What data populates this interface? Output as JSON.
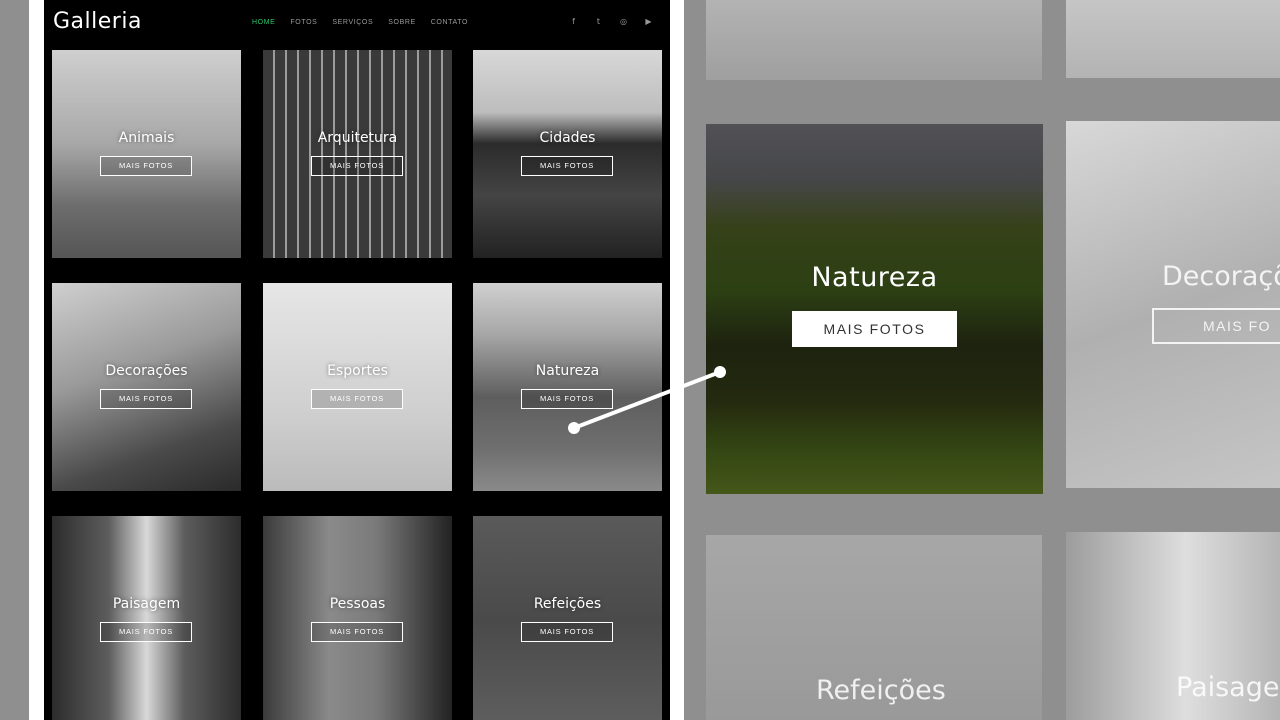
{
  "site": {
    "logo": "Galleria",
    "nav": [
      {
        "label": "HOME",
        "active": true
      },
      {
        "label": "FOTOS",
        "active": false
      },
      {
        "label": "SERVIÇOS",
        "active": false
      },
      {
        "label": "SOBRE",
        "active": false
      },
      {
        "label": "CONTATO",
        "active": false
      }
    ],
    "socials": [
      {
        "icon": "facebook-icon",
        "glyph": "f"
      },
      {
        "icon": "twitter-icon",
        "glyph": "t"
      },
      {
        "icon": "instagram-icon",
        "glyph": "◎"
      },
      {
        "icon": "youtube-icon",
        "glyph": "▶"
      }
    ],
    "accent_color": "#2ec66f",
    "tiles": [
      {
        "title": "Animais",
        "button": "MAIS FOTOS"
      },
      {
        "title": "Arquitetura",
        "button": "MAIS FOTOS"
      },
      {
        "title": "Cidades",
        "button": "MAIS FOTOS"
      },
      {
        "title": "Decorações",
        "button": "MAIS FOTOS"
      },
      {
        "title": "Esportes",
        "button": "MAIS FOTOS"
      },
      {
        "title": "Natureza",
        "button": "MAIS FOTOS"
      },
      {
        "title": "Paisagem",
        "button": "MAIS FOTOS"
      },
      {
        "title": "Pessoas",
        "button": "MAIS FOTOS"
      },
      {
        "title": "Refeições",
        "button": "MAIS FOTOS"
      }
    ]
  },
  "zoom": {
    "title": "Natureza",
    "button": "MAIS FOTOS",
    "ghost_right_title": "Decoraçõ",
    "ghost_right_button": "MAIS FO",
    "ghost_bottom_left": "Refeições",
    "ghost_bottom_right": "Paisagem"
  }
}
